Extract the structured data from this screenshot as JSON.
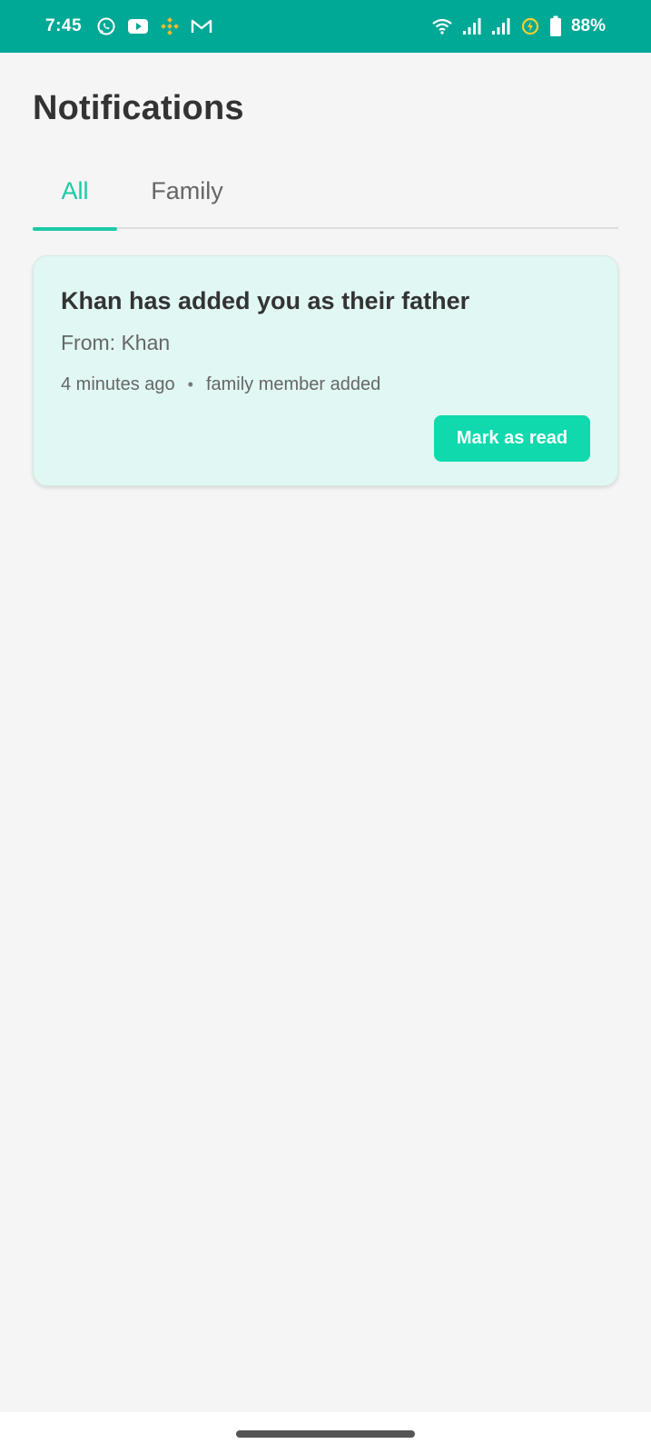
{
  "status_bar": {
    "time": "7:45",
    "battery_percent": "88%",
    "left_icons": [
      "whatsapp-icon",
      "youtube-icon",
      "binance-icon",
      "gmail-icon"
    ],
    "right_icons": [
      "wifi-icon",
      "signal-icon",
      "signal-icon",
      "battery-saver-icon",
      "battery-icon"
    ],
    "background_color": "#00a896"
  },
  "header": {
    "title": "Notifications"
  },
  "tabs": {
    "items": [
      {
        "label": "All",
        "selected": true
      },
      {
        "label": "Family",
        "selected": false
      }
    ],
    "accent_color": "#1ec9a6"
  },
  "notifications": [
    {
      "title": "Khan has added you as their father",
      "from": "From: Khan",
      "time": "4 minutes ago",
      "separator": "•",
      "type": "family member added",
      "action_label": "Mark as read",
      "background_color": "#e0f7f3",
      "button_color": "#10d9ae"
    }
  ]
}
